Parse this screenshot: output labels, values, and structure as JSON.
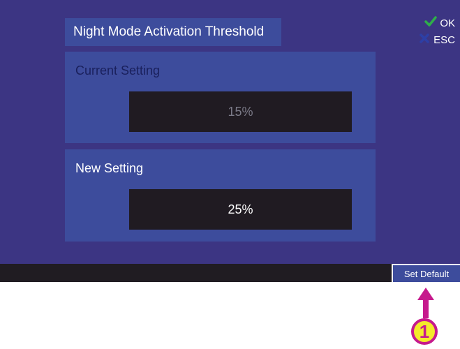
{
  "title": "Night Mode Activation Threshold",
  "actions": {
    "ok_label": "OK",
    "esc_label": "ESC"
  },
  "current": {
    "label": "Current Setting",
    "value": "15%"
  },
  "new": {
    "label": "New Setting",
    "value": "25%"
  },
  "footer": {
    "set_default_label": "Set Default"
  },
  "callout": {
    "number": "1"
  },
  "colors": {
    "background": "#3c3583",
    "panel": "#3d4c9c",
    "value_box": "#201b22",
    "ok_check": "#2fae4a",
    "esc_cross": "#2d3fa6",
    "callout_magenta": "#c61a8d",
    "callout_yellow": "#f4ea2a"
  },
  "icons": {
    "ok": "check-icon",
    "esc": "x-icon"
  }
}
